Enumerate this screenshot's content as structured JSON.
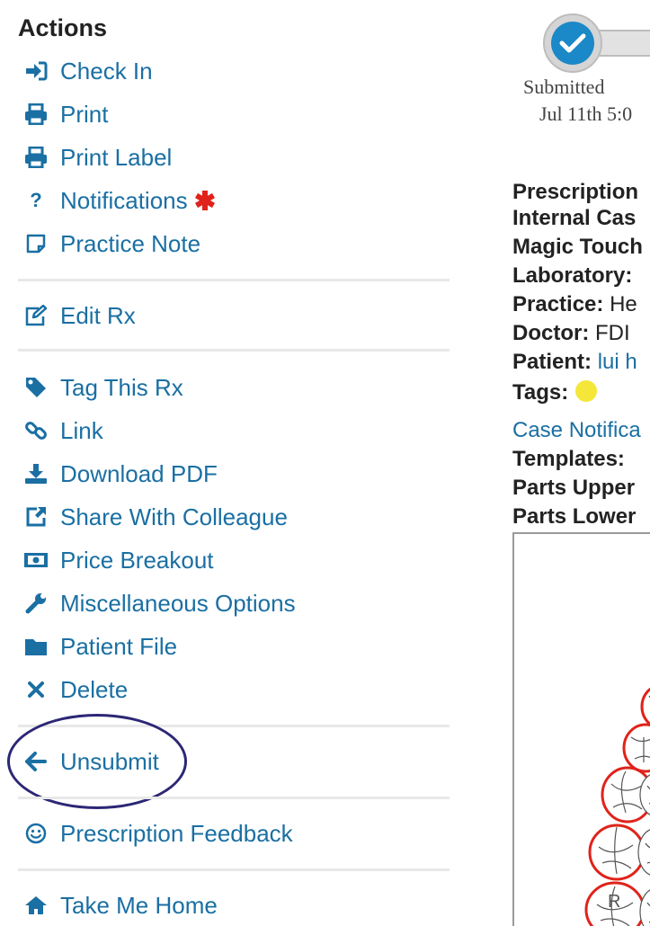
{
  "actions": {
    "title": "Actions",
    "items": [
      {
        "label": "Check In"
      },
      {
        "label": "Print"
      },
      {
        "label": "Print Label"
      },
      {
        "label": "Notifications"
      },
      {
        "label": "Practice Note"
      },
      {
        "label": "Edit Rx"
      },
      {
        "label": "Tag This Rx"
      },
      {
        "label": "Link"
      },
      {
        "label": "Download PDF"
      },
      {
        "label": "Share With Colleague"
      },
      {
        "label": "Price Breakout"
      },
      {
        "label": "Miscellaneous Options"
      },
      {
        "label": "Patient File"
      },
      {
        "label": "Delete"
      },
      {
        "label": "Unsubmit"
      },
      {
        "label": "Prescription Feedback"
      },
      {
        "label": "Take Me Home"
      }
    ]
  },
  "status": {
    "step_label": "Submitted",
    "step_date": "Jul 11th 5:0"
  },
  "details": {
    "prescription": "Prescription",
    "internal_case": "Internal Cas",
    "magic_touch": "Magic Touch",
    "laboratory": "Laboratory:",
    "practice_label": "Practice:",
    "practice_value": "He",
    "doctor_label": "Doctor:",
    "doctor_value": "FDI",
    "patient_label": "Patient:",
    "patient_value": "lui h",
    "tags_label": "Tags:",
    "case_notifications": "Case Notifica",
    "templates_label": "Templates:",
    "parts_upper": "Parts Upper",
    "parts_lower": "Parts Lower"
  },
  "tooth_chart": {
    "side_label": "R"
  },
  "colors": {
    "link": "#1a6fa3",
    "required": "#e0231b",
    "highlight_ring": "#2c2775",
    "tag": "#f5e73a",
    "progress": "#1b88c7"
  }
}
